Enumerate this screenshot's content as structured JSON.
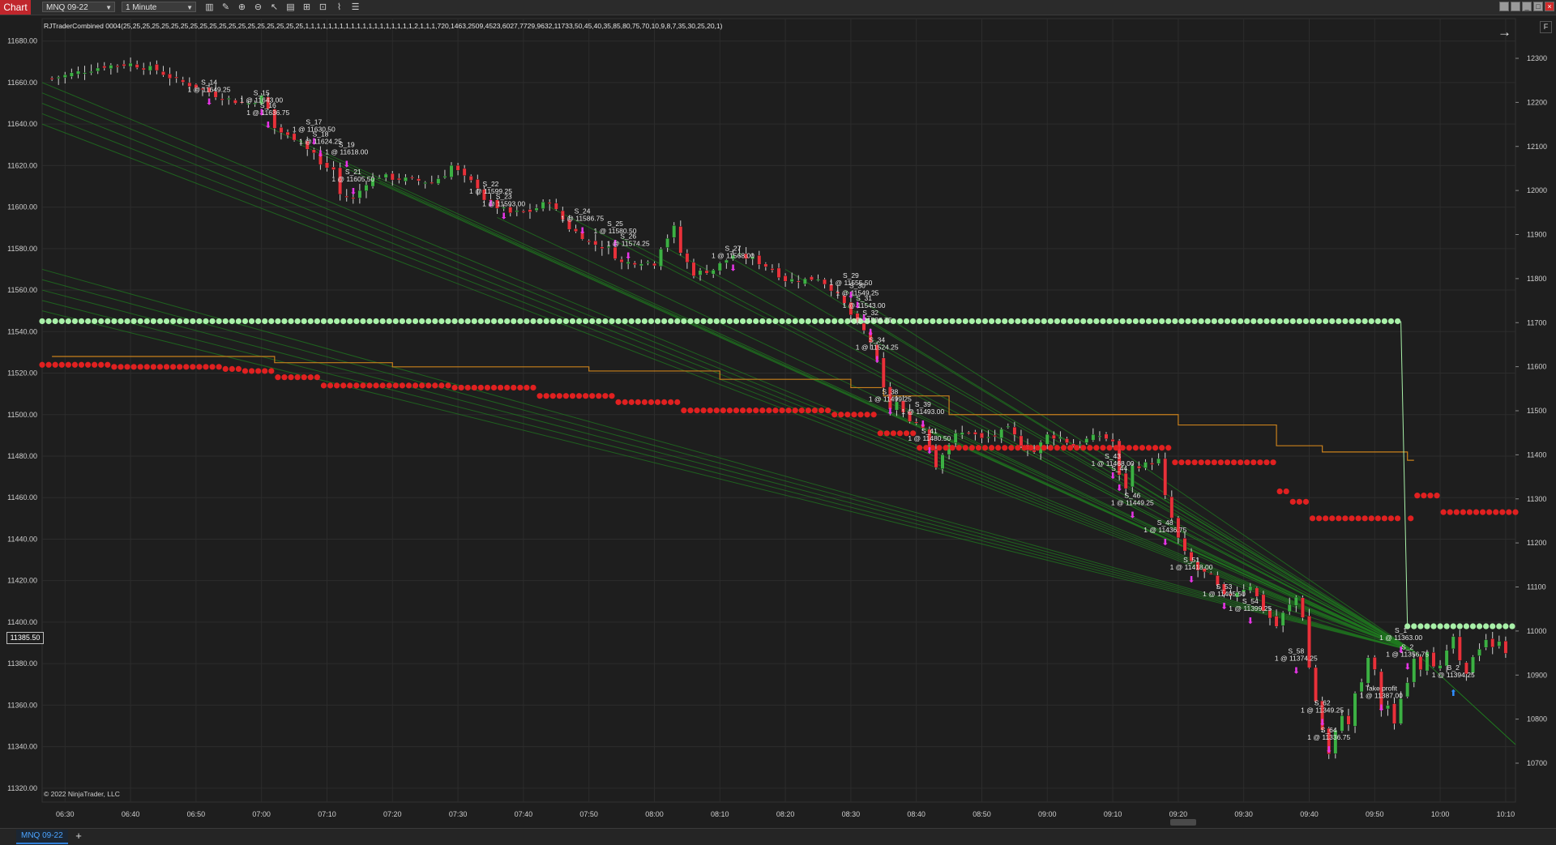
{
  "window": {
    "tab_label": "Chart",
    "instrument": "MNQ 09-22",
    "interval": "1 Minute",
    "toolbar_icons": [
      "bar-chart-icon",
      "pencil-icon",
      "zoom-in-icon",
      "zoom-out-icon",
      "pointer-icon",
      "properties-icon",
      "indicators-icon",
      "strategies-icon",
      "data-box-icon",
      "templates-icon"
    ],
    "window_buttons": [
      "tile-icon",
      "restore-icon",
      "minimize-icon",
      "maximize-icon",
      "close-icon"
    ]
  },
  "indicator_label": "RJTraderCombined 0004(25,25,25,25,25,25,25,25,25,25,25,25,25,25,25,25,25,25,25,1,1,1,1,1,1,1,1,1,1,1,1,1,1,1,1,1,1,1,2,1,1,1,720,1463,2509,4523,6027,7729,9632,11733,50,45,40,35,85,80,75,70,10,9,8,7,35,30,25,20,1)",
  "copyright": "© 2022 NinjaTrader, LLC",
  "current_price": "11385.50",
  "f_badge": "F",
  "bottom": {
    "instrument_tab": "MNQ 09-22",
    "add_tab": "+"
  },
  "chart_data": {
    "type": "candlestick",
    "left_axis": {
      "ticks": [
        "11680.00",
        "11660.00",
        "11640.00",
        "11620.00",
        "11600.00",
        "11580.00",
        "11560.00",
        "11540.00",
        "11520.00",
        "11500.00",
        "11480.00",
        "11460.00",
        "11440.00",
        "11420.00",
        "11400.00",
        "11380.00",
        "11360.00",
        "11340.00",
        "11320.00"
      ]
    },
    "right_axis": {
      "ticks": [
        "12300",
        "12200",
        "12100",
        "12000",
        "11900",
        "11800",
        "11700",
        "11600",
        "11500",
        "11400",
        "11300",
        "11200",
        "11100",
        "11000",
        "10900",
        "10800",
        "10700"
      ]
    },
    "x_ticks": [
      "06:30",
      "06:40",
      "06:50",
      "07:00",
      "07:10",
      "07:20",
      "07:30",
      "07:40",
      "07:50",
      "08:00",
      "08:10",
      "08:20",
      "08:30",
      "08:40",
      "08:50",
      "09:00",
      "09:10",
      "09:20",
      "09:30",
      "09:40",
      "09:50",
      "10:00",
      "10:10"
    ],
    "x_range_minutes": [
      26.5,
      251.5
    ],
    "y_range": [
      11313.3,
      11690.8
    ],
    "grid": true,
    "colors": {
      "up": "#3cb043",
      "down": "#e8313a",
      "signal_arrow": "#e635e6",
      "ma_line": "#c8801c",
      "upper_dots": "#a8f0a8",
      "lower_dots": "#e02020",
      "trend_lines": "#1f7a1f"
    },
    "close_path": [
      [
        28,
        11662
      ],
      [
        36,
        11668
      ],
      [
        40,
        11669
      ],
      [
        44,
        11666
      ],
      [
        47,
        11661
      ],
      [
        50,
        11658
      ],
      [
        53,
        11654
      ],
      [
        56,
        11651
      ],
      [
        58,
        11650
      ],
      [
        60,
        11653
      ],
      [
        61,
        11647
      ],
      [
        62,
        11638
      ],
      [
        64,
        11634
      ],
      [
        66,
        11633
      ],
      [
        67,
        11628
      ],
      [
        68,
        11626
      ],
      [
        69,
        11620
      ],
      [
        71,
        11618
      ],
      [
        72,
        11606
      ],
      [
        74,
        11604
      ],
      [
        76,
        11612
      ],
      [
        78,
        11615
      ],
      [
        80,
        11614
      ],
      [
        83,
        11613
      ],
      [
        86,
        11612
      ],
      [
        88,
        11616
      ],
      [
        89,
        11620
      ],
      [
        91,
        11614
      ],
      [
        93,
        11610
      ],
      [
        94,
        11604
      ],
      [
        96,
        11600
      ],
      [
        98,
        11597
      ],
      [
        101,
        11598
      ],
      [
        104,
        11603
      ],
      [
        105,
        11598
      ],
      [
        107,
        11590
      ],
      [
        109,
        11586
      ],
      [
        110,
        11583
      ],
      [
        113,
        11580
      ],
      [
        115,
        11573
      ],
      [
        118,
        11574
      ],
      [
        120,
        11573
      ],
      [
        121,
        11581
      ],
      [
        123,
        11590
      ],
      [
        124,
        11578
      ],
      [
        126,
        11568
      ],
      [
        129,
        11570
      ],
      [
        132,
        11577
      ],
      [
        135,
        11575
      ],
      [
        138,
        11570
      ],
      [
        140,
        11565
      ],
      [
        143,
        11565
      ],
      [
        145,
        11566
      ],
      [
        147,
        11561
      ],
      [
        149,
        11553
      ],
      [
        150,
        11548
      ],
      [
        151,
        11543
      ],
      [
        152,
        11540
      ],
      [
        153,
        11535
      ],
      [
        154,
        11525
      ],
      [
        155,
        11512
      ],
      [
        156,
        11503
      ],
      [
        157,
        11506
      ],
      [
        158,
        11500
      ],
      [
        160,
        11496
      ],
      [
        161,
        11494
      ],
      [
        162,
        11485
      ],
      [
        163,
        11475
      ],
      [
        164,
        11482
      ],
      [
        166,
        11490
      ],
      [
        168,
        11492
      ],
      [
        170,
        11488
      ],
      [
        172,
        11490
      ],
      [
        174,
        11493
      ],
      [
        176,
        11486
      ],
      [
        178,
        11482
      ],
      [
        180,
        11490
      ],
      [
        182,
        11489
      ],
      [
        184,
        11485
      ],
      [
        186,
        11488
      ],
      [
        188,
        11490
      ],
      [
        190,
        11487
      ],
      [
        191,
        11470
      ],
      [
        192,
        11465
      ],
      [
        193,
        11475
      ],
      [
        195,
        11476
      ],
      [
        197,
        11478
      ],
      [
        198,
        11460
      ],
      [
        200,
        11440
      ],
      [
        201,
        11433
      ],
      [
        203,
        11425
      ],
      [
        205,
        11422
      ],
      [
        207,
        11412
      ],
      [
        209,
        11415
      ],
      [
        211,
        11418
      ],
      [
        213,
        11406
      ],
      [
        215,
        11398
      ],
      [
        216,
        11404
      ],
      [
        218,
        11412
      ],
      [
        219,
        11403
      ],
      [
        220,
        11378
      ],
      [
        221,
        11362
      ],
      [
        222,
        11348
      ],
      [
        223,
        11336
      ],
      [
        224,
        11347
      ],
      [
        225,
        11356
      ],
      [
        226,
        11350
      ],
      [
        227,
        11366
      ],
      [
        228,
        11370
      ],
      [
        229,
        11383
      ],
      [
        230,
        11376
      ],
      [
        231,
        11358
      ],
      [
        232,
        11360
      ],
      [
        233,
        11350
      ],
      [
        234,
        11364
      ],
      [
        235,
        11371
      ],
      [
        236,
        11384
      ],
      [
        237,
        11378
      ],
      [
        238,
        11387
      ],
      [
        239,
        11380
      ],
      [
        240,
        11378
      ],
      [
        241,
        11385
      ],
      [
        242,
        11393
      ],
      [
        243,
        11380
      ],
      [
        244,
        11374
      ],
      [
        245,
        11384
      ],
      [
        246,
        11388
      ],
      [
        247,
        11392
      ],
      [
        248,
        11387
      ],
      [
        249,
        11392
      ],
      [
        250,
        11386
      ]
    ],
    "signals": [
      {
        "label": "S_14",
        "text": "1 @ 11649.25",
        "t": 52,
        "price": 11655
      },
      {
        "label": "S_15",
        "text": "1 @ 11643.00",
        "t": 60,
        "price": 11650
      },
      {
        "label": "S_16",
        "text": "1 @ 11636.75",
        "t": 61,
        "price": 11644
      },
      {
        "label": "S_17",
        "text": "1 @ 11630.50",
        "t": 68,
        "price": 11636
      },
      {
        "label": "S_18",
        "text": "1 @ 11624.25",
        "t": 69,
        "price": 11630
      },
      {
        "label": "S_19",
        "text": "1 @ 11618.00",
        "t": 73,
        "price": 11625
      },
      {
        "label": "S_21",
        "text": "1 @ 11605.50",
        "t": 74,
        "price": 11612
      },
      {
        "label": "S_22",
        "text": "1 @ 11599.25",
        "t": 95,
        "price": 11606
      },
      {
        "label": "S_23",
        "text": "1 @ 11593.00",
        "t": 97,
        "price": 11600
      },
      {
        "label": "S_24",
        "text": "1 @ 11586.75",
        "t": 109,
        "price": 11593
      },
      {
        "label": "S_25",
        "text": "1 @ 11580.50",
        "t": 114,
        "price": 11587
      },
      {
        "label": "S_26",
        "text": "1 @ 11574.25",
        "t": 116,
        "price": 11581
      },
      {
        "label": "S_27",
        "text": "1 @ 11568.00",
        "t": 132,
        "price": 11575
      },
      {
        "label": "S_29",
        "text": "1 @ 11555.50",
        "t": 150,
        "price": 11562
      },
      {
        "label": "S_30",
        "text": "1 @ 11549.25",
        "t": 151,
        "price": 11557
      },
      {
        "label": "S_31",
        "text": "1 @ 11543.00",
        "t": 152,
        "price": 11551
      },
      {
        "label": "S_32",
        "text": "1 @ 11536.75",
        "t": 153,
        "price": 11544
      },
      {
        "label": "S_34",
        "text": "1 @ 11524.25",
        "t": 154,
        "price": 11531
      },
      {
        "label": "S_38",
        "text": "1 @ 11499.25",
        "t": 156,
        "price": 11506
      },
      {
        "label": "S_39",
        "text": "1 @ 11493.00",
        "t": 161,
        "price": 11500
      },
      {
        "label": "S_41",
        "text": "1 @ 11480.50",
        "t": 162,
        "price": 11487
      },
      {
        "label": "S_43",
        "text": "1 @ 11468.00",
        "t": 190,
        "price": 11475
      },
      {
        "label": "S_44",
        "text": "",
        "t": 191,
        "price": 11469
      },
      {
        "label": "S_46",
        "text": "1 @ 11449.25",
        "t": 193,
        "price": 11456
      },
      {
        "label": "S_48",
        "text": "1 @ 11436.75",
        "t": 198,
        "price": 11443
      },
      {
        "label": "S_51",
        "text": "1 @ 11418.00",
        "t": 202,
        "price": 11425
      },
      {
        "label": "S_53",
        "text": "1 @ 11405.50",
        "t": 207,
        "price": 11412
      },
      {
        "label": "S_54",
        "text": "1 @ 11399.25",
        "t": 211,
        "price": 11405
      },
      {
        "label": "S_58",
        "text": "1 @ 11374.25",
        "t": 218,
        "price": 11381
      },
      {
        "label": "S_62",
        "text": "1 @ 11349.25",
        "t": 222,
        "price": 11356
      },
      {
        "label": "S_64",
        "text": "1 @ 11336.75",
        "t": 223,
        "price": 11343
      },
      {
        "label": "Take profit",
        "text": "1 @ 11387.00",
        "t": 231,
        "price": 11363
      },
      {
        "label": "S_1",
        "text": "1 @ 11363.00",
        "t": 234,
        "price": 11391
      },
      {
        "label": "S_2",
        "text": "1 @ 11356.75",
        "t": 235,
        "price": 11383
      },
      {
        "label": "B_2",
        "text": "1 @ 11394.25",
        "t": 242,
        "price": 11373
      }
    ],
    "upper_dots": {
      "level_1": 11545,
      "until_minute": 234,
      "level_2": 11398,
      "from_minute": 235
    },
    "lower_dots_steps": [
      [
        26.5,
        11524
      ],
      [
        37,
        11523
      ],
      [
        54,
        11522
      ],
      [
        57,
        11521
      ],
      [
        62,
        11518
      ],
      [
        69,
        11514
      ],
      [
        89,
        11513
      ],
      [
        102,
        11509
      ],
      [
        114,
        11506
      ],
      [
        124,
        11502
      ],
      [
        145,
        11502
      ],
      [
        147,
        11500
      ],
      [
        154,
        11491
      ],
      [
        160,
        11484
      ],
      [
        195,
        11484
      ],
      [
        199,
        11477
      ],
      [
        215,
        11463
      ],
      [
        217,
        11458
      ],
      [
        220,
        11450
      ],
      [
        236,
        11461
      ],
      [
        240,
        11453
      ],
      [
        251.5,
        11453
      ]
    ],
    "ma_steps": [
      [
        28,
        11528
      ],
      [
        58,
        11528
      ],
      [
        62,
        11525
      ],
      [
        80,
        11523
      ],
      [
        110,
        11521
      ],
      [
        130,
        11517
      ],
      [
        150,
        11513
      ],
      [
        155,
        11509
      ],
      [
        165,
        11500
      ],
      [
        200,
        11495
      ],
      [
        215,
        11485
      ],
      [
        222,
        11482
      ],
      [
        235,
        11478
      ]
    ],
    "trend_lines_target": {
      "t": 236,
      "price": 11386
    },
    "trend_lines_sources": [
      [
        26.5,
        11660
      ],
      [
        26.5,
        11655
      ],
      [
        26.5,
        11650
      ],
      [
        26.5,
        11645
      ],
      [
        26.5,
        11640
      ],
      [
        26.5,
        11570
      ],
      [
        26.5,
        11565
      ],
      [
        26.5,
        11560
      ],
      [
        26.5,
        11555
      ],
      [
        26.5,
        11550
      ],
      [
        60,
        11640
      ],
      [
        66,
        11630
      ],
      [
        72,
        11620
      ],
      [
        78,
        11612
      ],
      [
        96,
        11595
      ],
      [
        104,
        11600
      ],
      [
        115,
        11585
      ],
      [
        122,
        11580
      ],
      [
        132,
        11575
      ],
      [
        140,
        11570
      ],
      [
        149,
        11560
      ],
      [
        150,
        11550
      ],
      [
        153,
        11535
      ],
      [
        157,
        11505
      ],
      [
        162,
        11495
      ],
      [
        170,
        11493
      ],
      [
        180,
        11490
      ],
      [
        190,
        11485
      ],
      [
        198,
        11460
      ],
      [
        203,
        11432
      ],
      [
        207,
        11420
      ],
      [
        211,
        11412
      ],
      [
        214,
        11406
      ]
    ],
    "trend_tail": [
      [
        236,
        11386
      ],
      [
        251.5,
        11341
      ]
    ]
  }
}
